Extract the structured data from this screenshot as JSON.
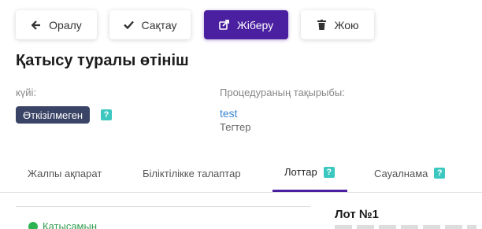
{
  "toolbar": {
    "back_label": "Оралу",
    "save_label": "Сақтау",
    "send_label": "Жіберу",
    "delete_label": "Жою"
  },
  "page": {
    "title": "Қатысу туралы өтініш"
  },
  "status": {
    "label": "күйі:",
    "value": "Өткізілмеген",
    "help": "?"
  },
  "procedure": {
    "label": "Процедураның тақырыбы:",
    "link": "test",
    "tags_label": "Тегтер"
  },
  "tabs": [
    {
      "label": "Жалпы ақпарат",
      "help": ""
    },
    {
      "label": "Біліктілікке талаптар",
      "help": ""
    },
    {
      "label": "Лоттар",
      "help": "?"
    },
    {
      "label": "Сауалнама",
      "help": "?"
    }
  ],
  "lots_panel": {
    "participate_label": "Қатысамын",
    "lot_title": "Лот №1"
  },
  "colors": {
    "accent": "#4a1fa0",
    "status_badge": "#3a4466",
    "help": "#3cc8c0",
    "link": "#3a86d0",
    "success": "#2eb352"
  },
  "icons": {
    "back": "arrow-left-icon",
    "save": "check-icon",
    "send": "share-icon",
    "delete": "trash-icon"
  }
}
